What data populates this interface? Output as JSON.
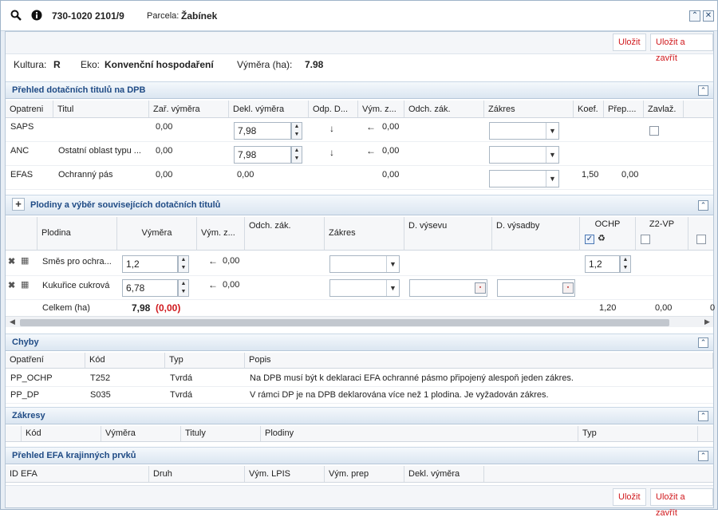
{
  "window": {
    "title_id": "730-1020 2101/9",
    "parcel_label": "Parcela:",
    "parcel_value": "Žabínek",
    "search_icon": "search-icon",
    "info_icon": "info-icon",
    "collapse_icon": "chevrons-up-icon",
    "close_icon": "close-icon"
  },
  "toolbar": {
    "save": "Uložit",
    "save_close": "Uložit a zavřít"
  },
  "info": {
    "kultura_label": "Kultura:",
    "kultura_value": "R",
    "eko_label": "Eko:",
    "eko_value": "Konvenční hospodaření",
    "vymera_label": "Výměra (ha):",
    "vymera_value": "7.98"
  },
  "dpb": {
    "title": "Přehled dotačních titulů na DPB",
    "columns": [
      "Opatreni",
      "Titul",
      "Zař. výměra",
      "Dekl. výměra",
      "Odp. D...",
      "Vým. z...",
      "Odch. zák.",
      "Zákres",
      "Koef.",
      "Přep....",
      "Zavlaž."
    ],
    "rows": [
      {
        "opatreni": "SAPS",
        "titul": "",
        "zar": "0,00",
        "dekl": "7,98",
        "vym_z": "0,00",
        "koef": "",
        "prep": ""
      },
      {
        "opatreni": "ANC",
        "titul": "Ostatní oblast typu ...",
        "zar": "0,00",
        "dekl": "7,98",
        "vym_z": "0,00",
        "koef": "",
        "prep": ""
      },
      {
        "opatreni": "EFAS",
        "titul": "Ochranný pás",
        "zar": "0,00",
        "dekl": "0,00",
        "vym_z": "0,00",
        "koef": "1,50",
        "prep": "0,00"
      }
    ]
  },
  "plodiny": {
    "title": "Plodiny a výběr souvisejících dotačních titulů",
    "columns": {
      "plodina": "Plodina",
      "vymera": "Výměra",
      "vym_z": "Vým. z...",
      "odch": "Odch. zák.",
      "zakres": "Zákres",
      "d_vysevu": "D. výsevu",
      "d_vysadby": "D. výsadby",
      "ochp": "OCHP",
      "z2vp": "Z2-VP"
    },
    "rows": [
      {
        "plodina": "Směs pro ochra...",
        "vymera": "1,2",
        "vym_z": "0,00",
        "ochp": "1,2"
      },
      {
        "plodina": "Kukuřice cukrová",
        "vymera": "6,78",
        "vym_z": "0,00",
        "ochp": ""
      }
    ],
    "total": {
      "label": "Celkem (ha)",
      "value": "7,98",
      "value_extra": "(0,00)",
      "ochp": "1,20",
      "z2vp": "0,00",
      "next": "0"
    }
  },
  "chyby": {
    "title": "Chyby",
    "columns": [
      "Opatření",
      "Kód",
      "Typ",
      "Popis"
    ],
    "rows": [
      {
        "opatreni": "PP_OCHP",
        "kod": "T252",
        "typ": "Tvrdá",
        "popis": "Na DPB musí být k deklaraci EFA ochranné pásmo připojený alespoň jeden zákres."
      },
      {
        "opatreni": "PP_DP",
        "kod": "S035",
        "typ": "Tvrdá",
        "popis": "V rámci DP je na DPB deklarována více než 1 plodina. Je vyžadován zákres."
      }
    ]
  },
  "zakresy": {
    "title": "Zákresy",
    "columns": [
      "Kód",
      "Výměra",
      "Tituly",
      "Plodiny",
      "Typ"
    ]
  },
  "efa": {
    "title": "Přehled EFA krajinných prvků",
    "columns": [
      "ID EFA",
      "Druh",
      "Vým. LPIS",
      "Vým. prep",
      "Dekl. výměra"
    ]
  }
}
